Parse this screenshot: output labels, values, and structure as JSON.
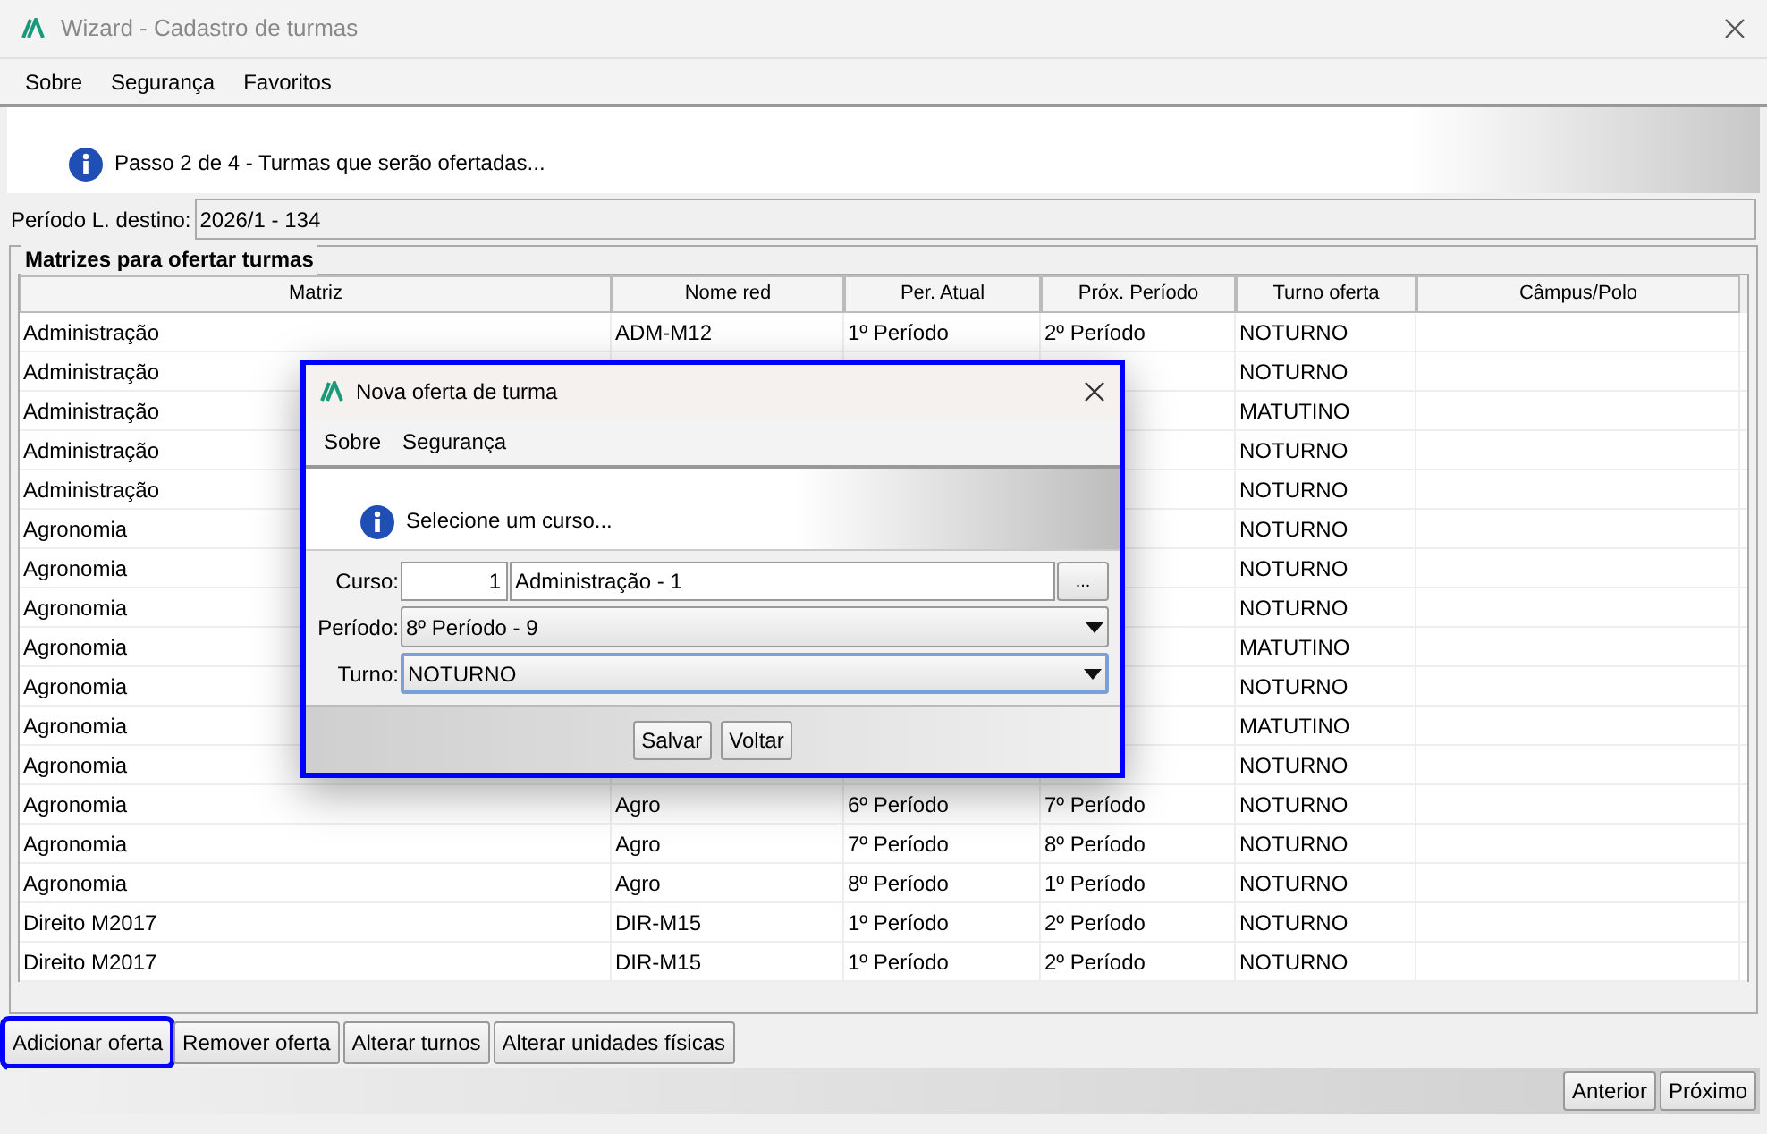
{
  "window": {
    "title": "Wizard - Cadastro de turmas"
  },
  "menu": [
    "Sobre",
    "Segurança",
    "Favoritos"
  ],
  "banner": {
    "text": "Passo 2 de 4 - Turmas que serão ofertadas..."
  },
  "destination": {
    "label": "Período L. destino:",
    "value": "2026/1 - 134"
  },
  "group": {
    "title": "Matrizes para ofertar turmas"
  },
  "table": {
    "columns": [
      "Matriz",
      "Nome red",
      "Per. Atual",
      "Próx. Período",
      "Turno oferta",
      "Câmpus/Polo"
    ],
    "rows": [
      [
        "Administração",
        "ADM-M12",
        "1º Período",
        "2º Período",
        "NOTURNO",
        ""
      ],
      [
        "Administração",
        "",
        "",
        "",
        "NOTURNO",
        ""
      ],
      [
        "Administração",
        "",
        "",
        "",
        "MATUTINO",
        ""
      ],
      [
        "Administração",
        "",
        "",
        "",
        "NOTURNO",
        ""
      ],
      [
        "Administração",
        "",
        "",
        "",
        "NOTURNO",
        ""
      ],
      [
        "Agronomia",
        "",
        "",
        "",
        "NOTURNO",
        ""
      ],
      [
        "Agronomia",
        "",
        "",
        "",
        "NOTURNO",
        ""
      ],
      [
        "Agronomia",
        "",
        "",
        "",
        "NOTURNO",
        ""
      ],
      [
        "Agronomia",
        "",
        "",
        "",
        "MATUTINO",
        ""
      ],
      [
        "Agronomia",
        "",
        "",
        "",
        "NOTURNO",
        ""
      ],
      [
        "Agronomia",
        "",
        "",
        "",
        "MATUTINO",
        ""
      ],
      [
        "Agronomia",
        "",
        "",
        "",
        "NOTURNO",
        ""
      ],
      [
        "Agronomia",
        "Agro",
        "6º Período",
        "7º Período",
        "NOTURNO",
        ""
      ],
      [
        "Agronomia",
        "Agro",
        "7º Período",
        "8º Período",
        "NOTURNO",
        ""
      ],
      [
        "Agronomia",
        "Agro",
        "8º Período",
        "1º Período",
        "NOTURNO",
        ""
      ],
      [
        "Direito M2017",
        "DIR-M15",
        "1º Período",
        "2º Período",
        "NOTURNO",
        ""
      ],
      [
        "Direito M2017",
        "DIR-M15",
        "1º Período",
        "2º Período",
        "NOTURNO",
        ""
      ]
    ]
  },
  "actions": [
    {
      "label": "Adicionar oferta",
      "highlighted": true
    },
    {
      "label": "Remover oferta",
      "highlighted": false
    },
    {
      "label": "Alterar turnos",
      "highlighted": false
    },
    {
      "label": "Alterar unidades físicas",
      "highlighted": false
    }
  ],
  "nav": [
    "Anterior",
    "Próximo"
  ],
  "dialog": {
    "title": "Nova oferta de turma",
    "highlighted": true,
    "menu": [
      "Sobre",
      "Segurança"
    ],
    "banner": "Selecione um curso...",
    "fields": [
      {
        "kind": "lookup",
        "label": "Curso:",
        "code": "1",
        "value": "Administração - 1",
        "button": "..."
      },
      {
        "kind": "select",
        "label": "Período:",
        "value": "8º Período - 9",
        "focused": false
      },
      {
        "kind": "select",
        "label": "Turno:",
        "value": "NOTURNO",
        "focused": true
      }
    ],
    "buttons": [
      "Salvar",
      "Voltar"
    ]
  }
}
